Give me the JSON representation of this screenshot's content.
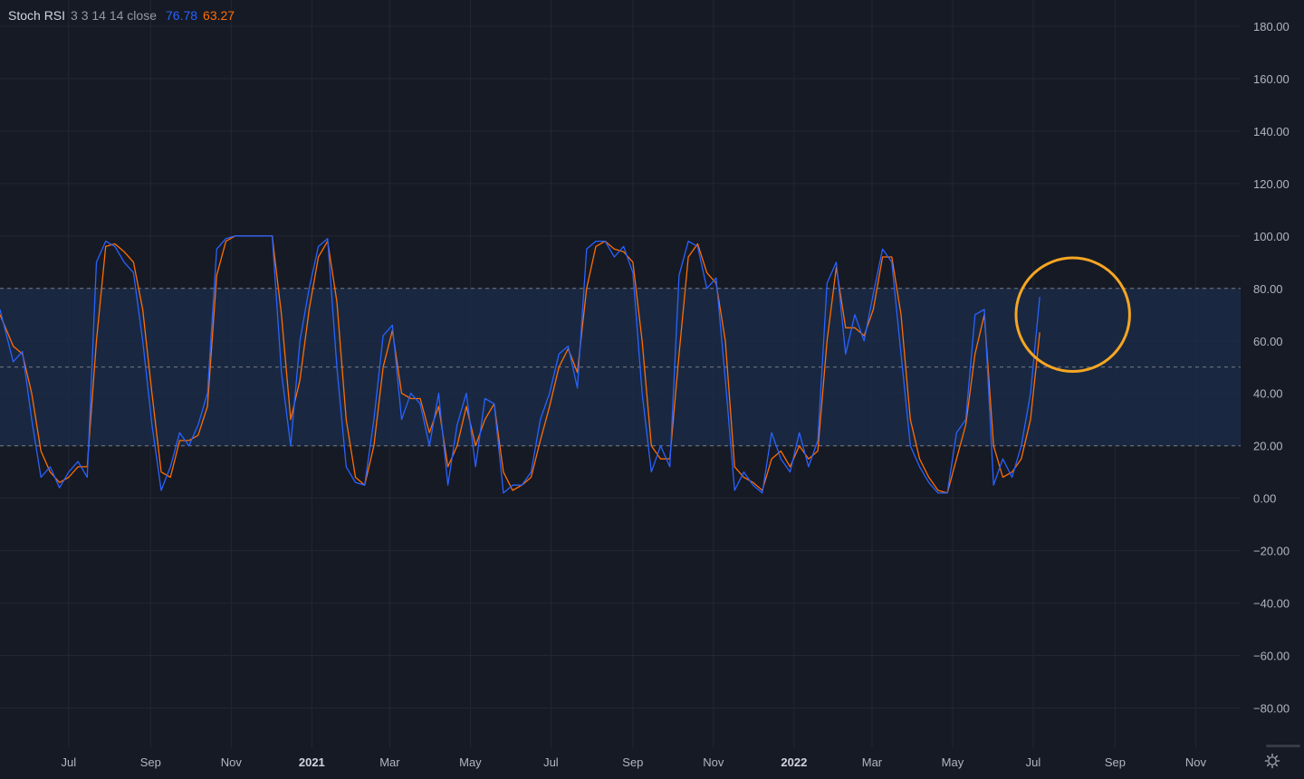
{
  "indicator": {
    "name": "Stoch RSI",
    "params": "3 3 14 14 close",
    "k_value": "76.78",
    "d_value": "63.27"
  },
  "colors": {
    "background": "#161a25",
    "grid": "#232733",
    "k_line": "#2962ff",
    "d_line": "#ff6d00",
    "band_fill": "#1a2b45",
    "band_dash": "#787b86",
    "axis_text": "#b2b5be",
    "highlight_circle": "#f5a623"
  },
  "chart_data": {
    "type": "line",
    "y_axis": {
      "ticks": [
        "180.00",
        "160.00",
        "140.00",
        "120.00",
        "100.00",
        "80.00",
        "60.00",
        "40.00",
        "20.00",
        "0.00",
        "−20.00",
        "−40.00",
        "−60.00",
        "−80.00"
      ],
      "tick_values": [
        180,
        160,
        140,
        120,
        100,
        80,
        60,
        40,
        20,
        0,
        -20,
        -40,
        -60,
        -80
      ],
      "range": [
        -95,
        190
      ]
    },
    "x_axis": {
      "labels": [
        "Jul",
        "Sep",
        "Nov",
        "2021",
        "Mar",
        "May",
        "Jul",
        "Sep",
        "Nov",
        "2022",
        "Mar",
        "May",
        "Jul",
        "Sep",
        "Nov"
      ],
      "bold": [
        false,
        false,
        false,
        true,
        false,
        false,
        false,
        false,
        false,
        true,
        false,
        false,
        false,
        false,
        false
      ],
      "x_values": [
        "2020-07-01",
        "2020-09-01",
        "2020-11-01",
        "2021-01-01",
        "2021-03-01",
        "2021-05-01",
        "2021-07-01",
        "2021-09-01",
        "2021-11-01",
        "2022-01-01",
        "2022-03-01",
        "2022-05-01",
        "2022-07-01",
        "2022-09-01",
        "2022-11-01"
      ],
      "range": [
        "2020-05-10",
        "2022-12-05"
      ]
    },
    "bands": {
      "upper": 80,
      "middle": 50,
      "lower": 20
    },
    "grid": true,
    "highlight": {
      "shape": "circle",
      "center": [
        "2022-07-31",
        70
      ],
      "radius_days": 43
    },
    "series": [
      {
        "id": "K",
        "dates": [
          "2020-05-10",
          "2020-05-20",
          "2020-05-27",
          "2020-06-03",
          "2020-06-10",
          "2020-06-17",
          "2020-06-24",
          "2020-07-01",
          "2020-07-08",
          "2020-07-15",
          "2020-07-22",
          "2020-07-29",
          "2020-08-05",
          "2020-08-12",
          "2020-08-19",
          "2020-08-26",
          "2020-09-02",
          "2020-09-09",
          "2020-09-16",
          "2020-09-23",
          "2020-09-30",
          "2020-10-07",
          "2020-10-14",
          "2020-10-21",
          "2020-10-28",
          "2020-11-04",
          "2020-11-11",
          "2020-11-18",
          "2020-11-25",
          "2020-12-02",
          "2020-12-09",
          "2020-12-16",
          "2020-12-23",
          "2020-12-30",
          "2021-01-06",
          "2021-01-13",
          "2021-01-20",
          "2021-01-27",
          "2021-02-03",
          "2021-02-10",
          "2021-02-17",
          "2021-02-24",
          "2021-03-03",
          "2021-03-10",
          "2021-03-17",
          "2021-03-24",
          "2021-03-31",
          "2021-04-07",
          "2021-04-14",
          "2021-04-21",
          "2021-04-28",
          "2021-05-05",
          "2021-05-12",
          "2021-05-19",
          "2021-05-26",
          "2021-06-02",
          "2021-06-09",
          "2021-06-16",
          "2021-06-23",
          "2021-06-30",
          "2021-07-07",
          "2021-07-14",
          "2021-07-21",
          "2021-07-28",
          "2021-08-04",
          "2021-08-11",
          "2021-08-18",
          "2021-08-25",
          "2021-09-01",
          "2021-09-08",
          "2021-09-15",
          "2021-09-22",
          "2021-09-29",
          "2021-10-06",
          "2021-10-13",
          "2021-10-20",
          "2021-10-27",
          "2021-11-03",
          "2021-11-10",
          "2021-11-17",
          "2021-11-24",
          "2021-12-01",
          "2021-12-08",
          "2021-12-15",
          "2021-12-22",
          "2021-12-29",
          "2022-01-05",
          "2022-01-12",
          "2022-01-19",
          "2022-01-26",
          "2022-02-02",
          "2022-02-09",
          "2022-02-16",
          "2022-02-23",
          "2022-03-02",
          "2022-03-09",
          "2022-03-16",
          "2022-03-23",
          "2022-03-30",
          "2022-04-06",
          "2022-04-13",
          "2022-04-20",
          "2022-04-27",
          "2022-05-04",
          "2022-05-11",
          "2022-05-18",
          "2022-05-25",
          "2022-06-01",
          "2022-06-08",
          "2022-06-15",
          "2022-06-22",
          "2022-06-29",
          "2022-07-06",
          "2022-07-13"
        ],
        "values": [
          72,
          52,
          56,
          30,
          8,
          12,
          4,
          10,
          14,
          8,
          90,
          98,
          96,
          90,
          86,
          60,
          28,
          3,
          12,
          25,
          20,
          28,
          40,
          95,
          99,
          100,
          100,
          100,
          100,
          100,
          48,
          20,
          60,
          80,
          96,
          99,
          50,
          12,
          6,
          5,
          30,
          62,
          66,
          30,
          40,
          36,
          20,
          40,
          5,
          28,
          40,
          12,
          38,
          36,
          2,
          5,
          5,
          10,
          30,
          40,
          55,
          58,
          42,
          95,
          98,
          98,
          92,
          96,
          86,
          40,
          10,
          20,
          12,
          85,
          98,
          96,
          80,
          84,
          45,
          3,
          10,
          5,
          2,
          25,
          15,
          10,
          25,
          12,
          22,
          82,
          90,
          55,
          70,
          60,
          78,
          95,
          90,
          55,
          20,
          12,
          6,
          2,
          2,
          25,
          30,
          70,
          72,
          5,
          15,
          8,
          20,
          40,
          76.78
        ]
      },
      {
        "id": "D",
        "dates": [
          "2020-05-10",
          "2020-05-20",
          "2020-05-27",
          "2020-06-03",
          "2020-06-10",
          "2020-06-17",
          "2020-06-24",
          "2020-07-01",
          "2020-07-08",
          "2020-07-15",
          "2020-07-22",
          "2020-07-29",
          "2020-08-05",
          "2020-08-12",
          "2020-08-19",
          "2020-08-26",
          "2020-09-02",
          "2020-09-09",
          "2020-09-16",
          "2020-09-23",
          "2020-09-30",
          "2020-10-07",
          "2020-10-14",
          "2020-10-21",
          "2020-10-28",
          "2020-11-04",
          "2020-11-11",
          "2020-11-18",
          "2020-11-25",
          "2020-12-02",
          "2020-12-09",
          "2020-12-16",
          "2020-12-23",
          "2020-12-30",
          "2021-01-06",
          "2021-01-13",
          "2021-01-20",
          "2021-01-27",
          "2021-02-03",
          "2021-02-10",
          "2021-02-17",
          "2021-02-24",
          "2021-03-03",
          "2021-03-10",
          "2021-03-17",
          "2021-03-24",
          "2021-03-31",
          "2021-04-07",
          "2021-04-14",
          "2021-04-21",
          "2021-04-28",
          "2021-05-05",
          "2021-05-12",
          "2021-05-19",
          "2021-05-26",
          "2021-06-02",
          "2021-06-09",
          "2021-06-16",
          "2021-06-23",
          "2021-06-30",
          "2021-07-07",
          "2021-07-14",
          "2021-07-21",
          "2021-07-28",
          "2021-08-04",
          "2021-08-11",
          "2021-08-18",
          "2021-08-25",
          "2021-09-01",
          "2021-09-08",
          "2021-09-15",
          "2021-09-22",
          "2021-09-29",
          "2021-10-06",
          "2021-10-13",
          "2021-10-20",
          "2021-10-27",
          "2021-11-03",
          "2021-11-10",
          "2021-11-17",
          "2021-11-24",
          "2021-12-01",
          "2021-12-08",
          "2021-12-15",
          "2021-12-22",
          "2021-12-29",
          "2022-01-05",
          "2022-01-12",
          "2022-01-19",
          "2022-01-26",
          "2022-02-02",
          "2022-02-09",
          "2022-02-16",
          "2022-02-23",
          "2022-03-02",
          "2022-03-09",
          "2022-03-16",
          "2022-03-23",
          "2022-03-30",
          "2022-04-06",
          "2022-04-13",
          "2022-04-20",
          "2022-04-27",
          "2022-05-04",
          "2022-05-11",
          "2022-05-18",
          "2022-05-25",
          "2022-06-01",
          "2022-06-08",
          "2022-06-15",
          "2022-06-22",
          "2022-06-29",
          "2022-07-06",
          "2022-07-13"
        ],
        "values": [
          70,
          58,
          55,
          40,
          18,
          10,
          6,
          8,
          12,
          12,
          60,
          96,
          97,
          94,
          90,
          72,
          40,
          10,
          8,
          22,
          22,
          24,
          35,
          85,
          98,
          100,
          100,
          100,
          100,
          100,
          70,
          30,
          45,
          72,
          92,
          98,
          75,
          30,
          8,
          5,
          20,
          50,
          64,
          40,
          38,
          38,
          25,
          35,
          12,
          20,
          35,
          20,
          30,
          36,
          10,
          3,
          5,
          8,
          22,
          35,
          50,
          57,
          48,
          80,
          96,
          98,
          95,
          94,
          90,
          60,
          20,
          15,
          15,
          55,
          92,
          97,
          86,
          82,
          60,
          12,
          8,
          6,
          3,
          15,
          18,
          12,
          20,
          15,
          18,
          60,
          88,
          65,
          65,
          62,
          72,
          92,
          92,
          70,
          30,
          15,
          8,
          3,
          2,
          15,
          28,
          55,
          70,
          20,
          8,
          10,
          15,
          30,
          63.27
        ]
      }
    ]
  }
}
